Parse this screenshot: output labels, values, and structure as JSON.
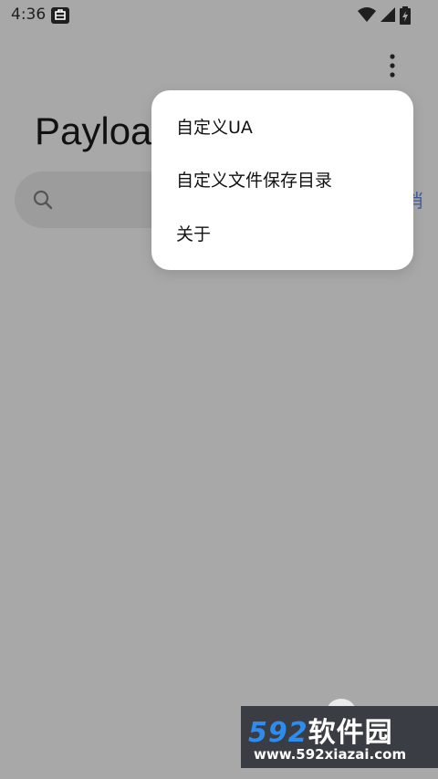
{
  "status_bar": {
    "time": "4:36",
    "icons": [
      "notification-icon",
      "wifi-icon",
      "cellular-signal-icon",
      "battery-charging-icon"
    ]
  },
  "app": {
    "title": "Payloa",
    "cancel_label": "消",
    "overflow_icon": "more-vert-icon",
    "search_icon": "search-icon"
  },
  "menu": {
    "items": [
      {
        "label": "自定义UA"
      },
      {
        "label": "自定义文件保存目录"
      },
      {
        "label": "关于"
      }
    ]
  },
  "watermark": {
    "logo_number": "592",
    "logo_text": "软件园",
    "url": "www.592xiazai.com"
  },
  "colors": {
    "scrim_background": "#a8a8a8",
    "menu_background": "#ffffff",
    "accent_text": "#3f5f9c",
    "watermark_blue": "#2d8cf0"
  }
}
